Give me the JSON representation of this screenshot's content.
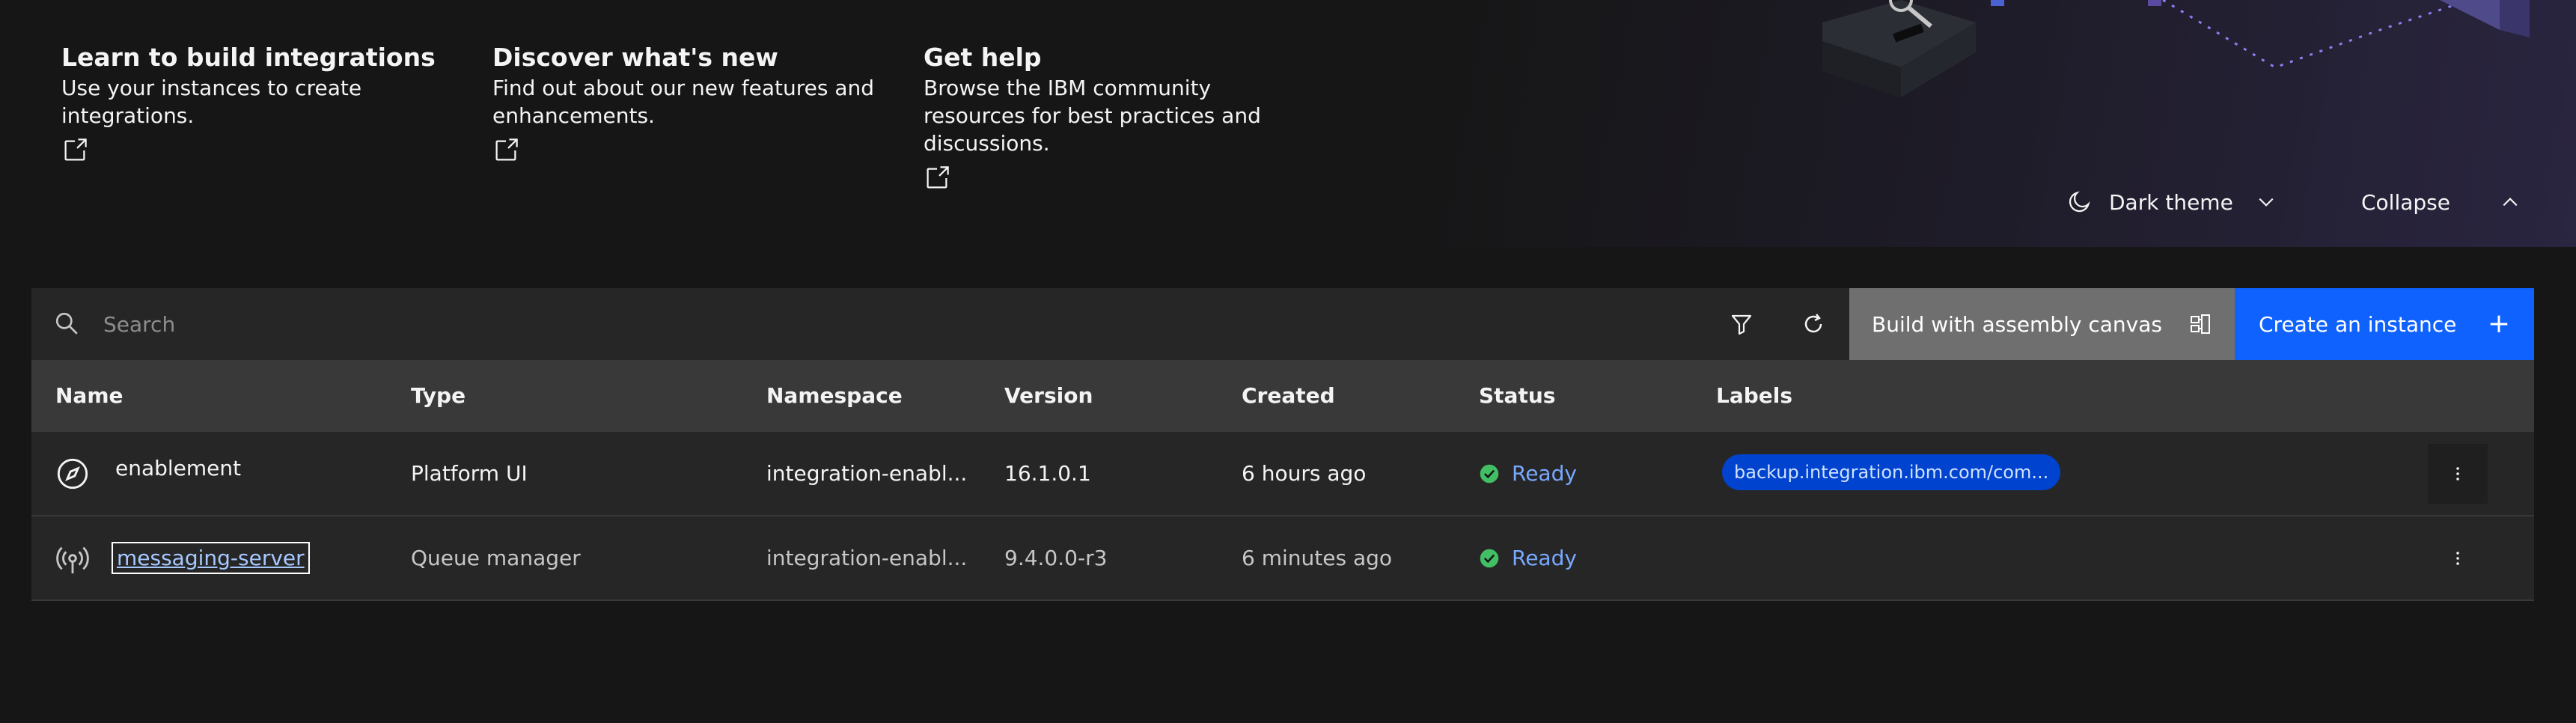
{
  "cards": [
    {
      "title": "Learn to build integrations",
      "desc_line1": "Use your instances to create",
      "desc_line2": "integrations.",
      "desc_line3": ""
    },
    {
      "title": "Discover what's new",
      "desc_line1": "Find out about our new features and",
      "desc_line2": "enhancements.",
      "desc_line3": ""
    },
    {
      "title": "Get help",
      "desc_line1": "Browse the IBM community",
      "desc_line2": "resources for best practices and",
      "desc_line3": "discussions."
    }
  ],
  "theme": {
    "label": "Dark theme"
  },
  "collapse": {
    "label": "Collapse"
  },
  "toolbar": {
    "search_placeholder": "Search",
    "build_label": "Build with assembly canvas",
    "create_label": "Create an instance",
    "create_icon": "+"
  },
  "table": {
    "headers": [
      "Name",
      "Type",
      "Namespace",
      "Version",
      "Created",
      "Status",
      "Labels"
    ],
    "rows": [
      {
        "name": "enablement",
        "type": "Platform UI",
        "namespace": "integration-enabl...",
        "version": "16.1.0.1",
        "created": "6 hours ago",
        "status": "Ready",
        "label": "backup.integration.ibm.com/com...",
        "icon": "compass-icon"
      },
      {
        "name": "messaging-server",
        "type": "Queue manager",
        "namespace": "integration-enabl...",
        "version": "9.4.0.0-r3",
        "created": "6 minutes ago",
        "status": "Ready",
        "label": "",
        "icon": "broadcast-icon"
      }
    ]
  },
  "colors": {
    "accent": "#0f62fe",
    "status_ok": "#42be65",
    "status_text": "#78a9ff",
    "tag_bg": "#0043ce"
  }
}
